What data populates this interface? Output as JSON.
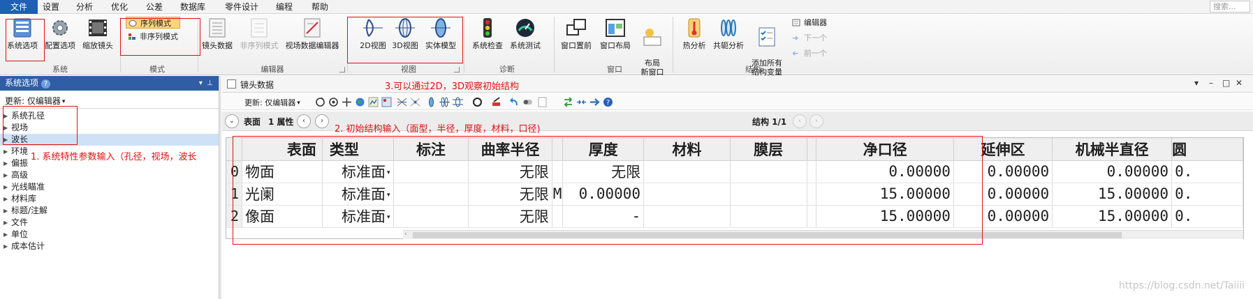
{
  "menubar": {
    "file": "文件",
    "items": [
      "设置",
      "分析",
      "优化",
      "公差",
      "数据库",
      "零件设计",
      "编程",
      "帮助"
    ],
    "search_placeholder": "搜索..."
  },
  "ribbon": {
    "buttons": {
      "system_options": "系统选项",
      "config_options": "配置选项",
      "zoom_lens": "缩放镜头",
      "lens_data": "镜头数据",
      "nonseq_mode_disabled": "非序列模式",
      "field_data_editor": "视场数据编辑器",
      "view2d": "2D视图",
      "view3d": "3D视图",
      "solid_model": "实体模型",
      "system_check": "系统检查",
      "system_test": "系统测试",
      "window_front": "窗口置前",
      "window_layout": "窗口布局",
      "new_layout_window": "布局\n新窗口",
      "thermal_analysis": "热分析",
      "conjugate_analysis": "共轭分析",
      "add_all_struct_vars": "添加所有\n结构变量"
    },
    "mode_items": {
      "sequential": "序列模式",
      "nonsequential": "非序列模式"
    },
    "nav_items": {
      "editor": "编辑器",
      "next": "下一个",
      "prev": "前一个"
    },
    "groups": {
      "system": "系统",
      "mode": "模式",
      "editors": "编辑器",
      "view": "视图",
      "diagnostics": "诊断",
      "window": "窗口",
      "structure": "结构:"
    }
  },
  "left_pane": {
    "title": "系统选项",
    "update_label": "更新: 仅编辑器",
    "items": [
      "系统孔径",
      "视场",
      "波长",
      "环境",
      "偏振",
      "高级",
      "光线瞄准",
      "材料库",
      "标题/注解",
      "文件",
      "单位",
      "成本估计"
    ]
  },
  "doc": {
    "title": "镜头数据",
    "update_label": "更新: 仅编辑器",
    "surface_label": "表面",
    "prop_label": "1 属性",
    "structure_label": "结构 1/1"
  },
  "grid": {
    "headers": [
      "表面",
      "类型",
      "标注",
      "曲率半径",
      "厚度",
      "材料",
      "膜层",
      "净口径",
      "延伸区",
      "机械半直径",
      "圆"
    ],
    "rows": [
      {
        "num": "0",
        "surface": "物面",
        "type": "标准面",
        "note": "",
        "radius": "无限",
        "radius_solve": "",
        "thickness": "无限",
        "thickness_solve": "",
        "material": "",
        "coating": "",
        "clear_aperture": "0.00000",
        "extension": "0.00000",
        "mech_semi_dia": "0.00000",
        "next": "0."
      },
      {
        "num": "1",
        "surface": "光阑",
        "type": "标准面",
        "note": "",
        "radius": "无限",
        "radius_solve": "M",
        "thickness": "0.00000",
        "thickness_solve": "",
        "material": "",
        "coating": "",
        "clear_aperture": "15.00000",
        "extension": "0.00000",
        "mech_semi_dia": "15.00000",
        "next": "0."
      },
      {
        "num": "2",
        "surface": "像面",
        "type": "标准面",
        "note": "",
        "radius": "无限",
        "radius_solve": "",
        "thickness": "-",
        "thickness_solve": "",
        "material": "",
        "coating": "",
        "clear_aperture": "15.00000",
        "extension": "0.00000",
        "mech_semi_dia": "15.00000",
        "next": "0."
      }
    ]
  },
  "annotations": {
    "note1": "1. 系统特性参数输入（孔径，视场，波长",
    "note2": "2. 初始结构输入（面型，半径，厚度，材料，口径)",
    "note3": "3.可以通过2D，3D观察初始结构"
  },
  "watermark": "https://blog.csdn.net/Taiiii",
  "colors": {
    "accent": "#1f5fb4",
    "annotation": "#e01010",
    "left_header": "#2f5ea7"
  }
}
